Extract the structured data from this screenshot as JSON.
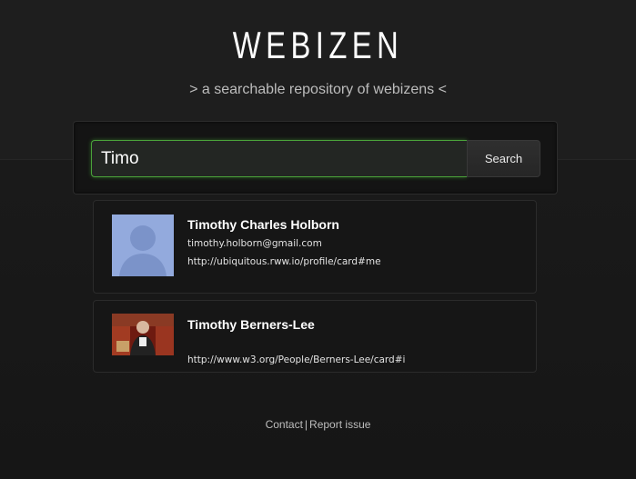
{
  "header": {
    "brand": "WEBIZEN",
    "tagline": "> a searchable repository of webizens <"
  },
  "search": {
    "query": "Timo",
    "button_label": "Search"
  },
  "results": [
    {
      "name": "Timothy Charles Holborn",
      "email": "timothy.holborn@gmail.com",
      "uri": "http://ubiquitous.rww.io/profile/card#me",
      "avatar": "default-profile-silhouette"
    },
    {
      "name": "Timothy Berners-Lee",
      "email": "",
      "uri": "http://www.w3.org/People/Berners-Lee/card#i",
      "avatar": "profile-photo"
    }
  ],
  "footer": {
    "contact_label": "Contact",
    "separator": "|",
    "report_label": "Report issue"
  }
}
